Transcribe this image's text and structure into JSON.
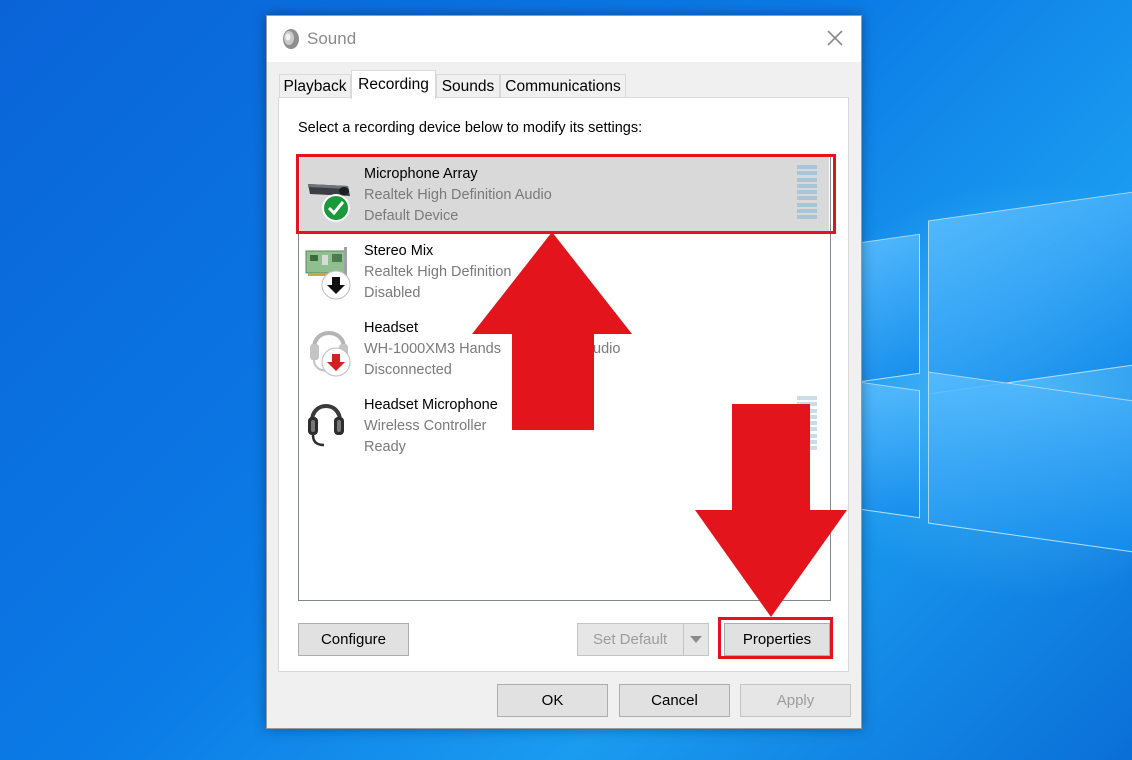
{
  "window": {
    "title": "Sound",
    "icon": "speaker-icon"
  },
  "tabs": [
    {
      "label": "Playback",
      "active": false
    },
    {
      "label": "Recording",
      "active": true
    },
    {
      "label": "Sounds",
      "active": false
    },
    {
      "label": "Communications",
      "active": false
    }
  ],
  "instruction": "Select a recording device below to modify its settings:",
  "devices": [
    {
      "name": "Microphone Array",
      "driver": "Realtek High Definition Audio",
      "status": "Default Device",
      "icon": "microphone-array-icon",
      "badge": "green-check-badge",
      "selected": true
    },
    {
      "name": "Stereo Mix",
      "driver": "Realtek High Definition",
      "status": "Disabled",
      "icon": "sound-card-icon",
      "badge": "black-down-arrow-badge",
      "selected": false
    },
    {
      "name": "Headset",
      "driver": "WH-1000XM3 Hands",
      "driver_tail": "udio",
      "status": "Disconnected",
      "icon": "headset-icon",
      "badge": "red-down-arrow-badge",
      "selected": false
    },
    {
      "name": "Headset Microphone",
      "driver": "Wireless Controller",
      "status": "Ready",
      "icon": "headset-microphone-icon",
      "badge": "",
      "selected": false
    }
  ],
  "buttons": {
    "configure": "Configure",
    "set_default": "Set Default",
    "properties": "Properties",
    "ok": "OK",
    "cancel": "Cancel",
    "apply": "Apply"
  },
  "colors": {
    "highlight": "#e3141b",
    "selected_row": "#d9d9d9",
    "desktop": "#0b7be6"
  }
}
